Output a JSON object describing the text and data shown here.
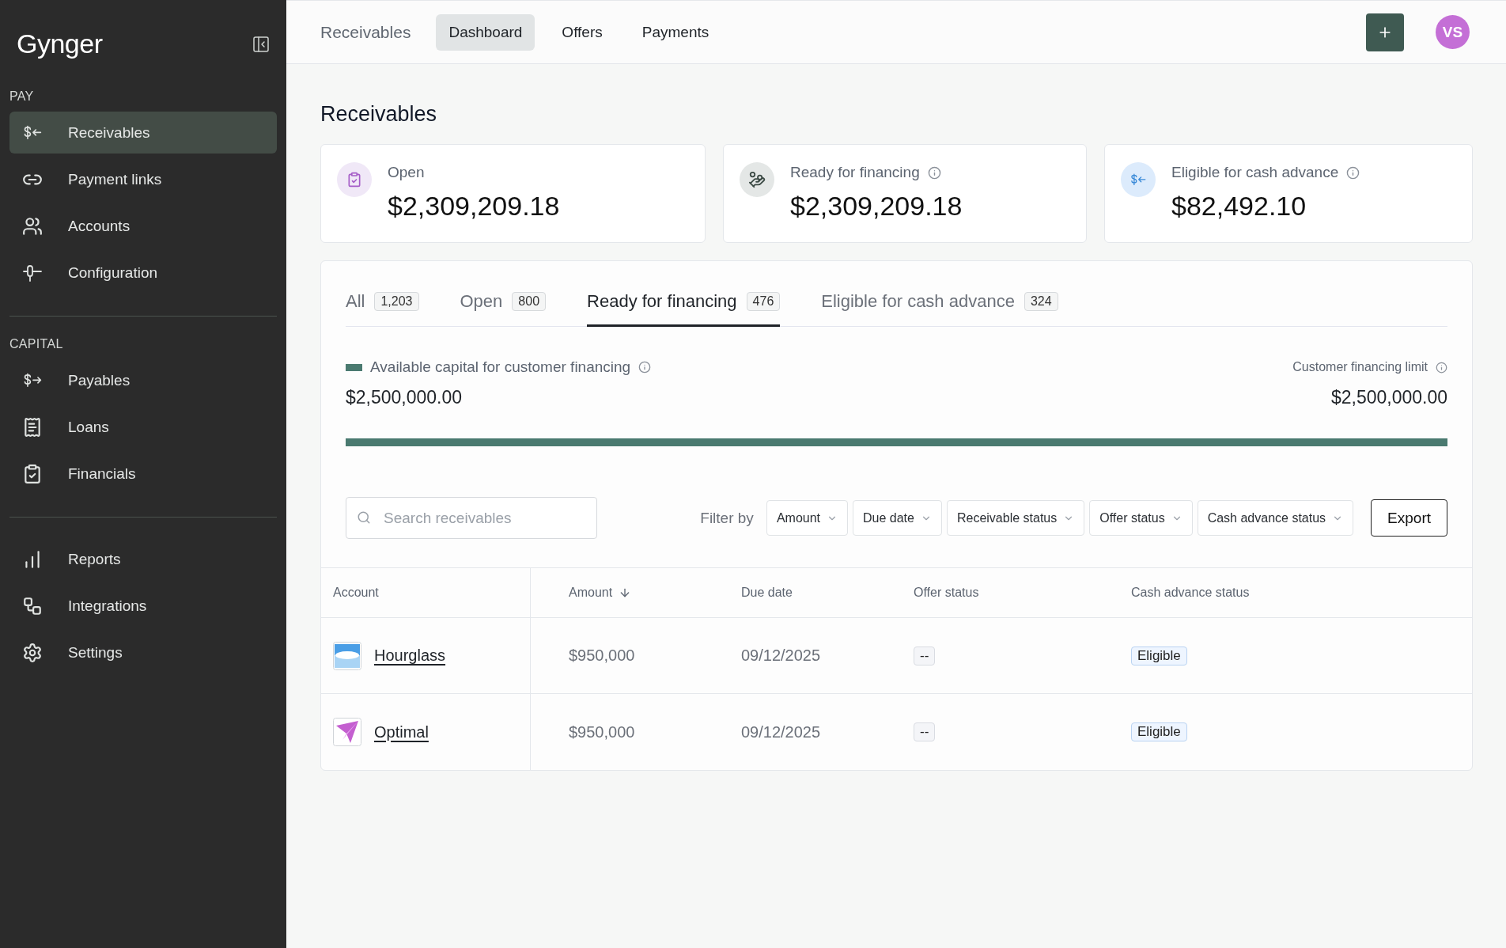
{
  "sidebar": {
    "logo": "Gynger",
    "sections": [
      {
        "title": "PAY",
        "items": [
          {
            "label": "Receivables",
            "selected": true
          },
          {
            "label": "Payment links",
            "selected": false
          },
          {
            "label": "Accounts",
            "selected": false
          },
          {
            "label": "Configuration",
            "selected": false
          }
        ]
      },
      {
        "title": "CAPITAL",
        "items": [
          {
            "label": "Payables",
            "selected": false
          },
          {
            "label": "Loans",
            "selected": false
          },
          {
            "label": "Financials",
            "selected": false
          }
        ]
      },
      {
        "items": [
          {
            "label": "Reports",
            "selected": false
          },
          {
            "label": "Integrations",
            "selected": false
          },
          {
            "label": "Settings",
            "selected": false
          }
        ]
      }
    ]
  },
  "top_nav": {
    "title": "Receivables",
    "tabs": [
      {
        "label": "Dashboard",
        "selected": true
      },
      {
        "label": "Offers",
        "selected": false
      },
      {
        "label": "Payments",
        "selected": false
      }
    ],
    "avatar": "VS"
  },
  "page_title": "Receivables",
  "summary_cards": [
    {
      "label": "Open",
      "value": "$2,309,209.18",
      "info": false
    },
    {
      "label": "Ready for financing",
      "value": "$2,309,209.18",
      "info": true
    },
    {
      "label": "Eligible for cash advance",
      "value": "$82,492.10",
      "info": true
    }
  ],
  "tabs": [
    {
      "label": "All",
      "count": "1,203",
      "selected": false
    },
    {
      "label": "Open",
      "count": "800",
      "selected": false
    },
    {
      "label": "Ready for financing",
      "count": "476",
      "selected": true
    },
    {
      "label": "Eligible for cash advance",
      "count": "324",
      "selected": false
    }
  ],
  "capital": {
    "label": "Available capital for customer financing",
    "amount": "$2,500,000.00",
    "limit_label": "Customer financing limit",
    "limit_amount": "$2,500,000.00",
    "level": 1
  },
  "toolbar": {
    "search": {
      "placeholder": "Search receivables"
    },
    "filter_label": "Filter by",
    "filters": [
      "Amount",
      "Due date",
      "Receivable status",
      "Offer status",
      "Cash advance status"
    ],
    "export": "Export"
  },
  "table": {
    "columns": [
      {
        "label": "Account",
        "sorted": false
      },
      {
        "label": "Amount",
        "sorted": true
      },
      {
        "label": "Due date",
        "sorted": false
      },
      {
        "label": "Offer status",
        "sorted": false
      },
      {
        "label": "Cash advance status",
        "sorted": false
      }
    ],
    "rows": [
      {
        "account": "Hourglass",
        "amount": "$950,000",
        "due_date": "09/12/2025",
        "offer_status": "--",
        "cash_advance_status": "Eligible"
      },
      {
        "account": "Optimal",
        "amount": "$950,000",
        "due_date": "09/12/2025",
        "offer_status": "--",
        "cash_advance_status": "Eligible"
      }
    ]
  }
}
